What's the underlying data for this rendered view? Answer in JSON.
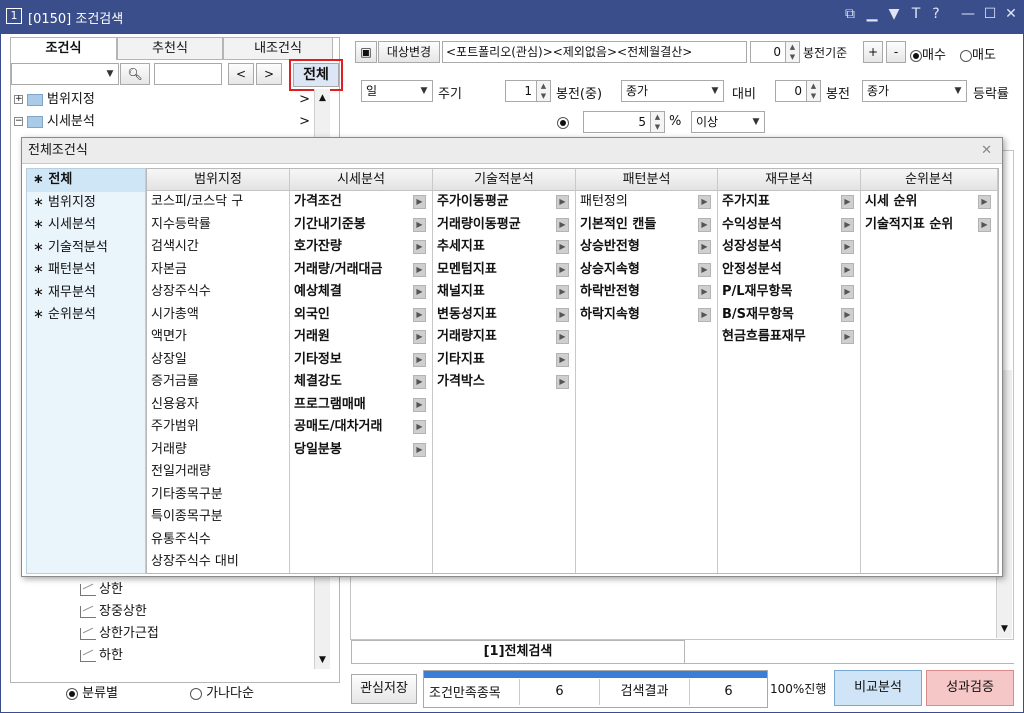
{
  "window": {
    "number": "1",
    "title": "[0150] 조건검색",
    "controls": [
      "restore-icon",
      "minimize-icon",
      "pin-icon",
      "text-icon",
      "help-icon",
      "minimize-icon",
      "maximize-icon",
      "close-icon"
    ]
  },
  "left_panel": {
    "tabs": [
      "조건식",
      "추천식",
      "내조건식"
    ],
    "active_tab": "조건식",
    "all_button": "전체",
    "tree": [
      {
        "label": "범위지정"
      },
      {
        "label": "시세분석"
      }
    ],
    "leaf_items": [
      "상한",
      "장중상한",
      "상한가근접",
      "하한"
    ],
    "sort_options": [
      "분류별",
      "가나다순"
    ],
    "selected_sort": "분류별"
  },
  "top_bar": {
    "target_button": "대상변경",
    "target_text": "<포트폴리오(관심)><제외없음><전체월결산>",
    "bong_count": "0",
    "bong_label": "봉전기준",
    "plus": "+",
    "minus": "-",
    "buy": "매수",
    "sell": "매도"
  },
  "condition_row": {
    "period_value": "일",
    "period_label": "주기",
    "bong_mid_value": "1",
    "bong_mid_label": "봉전(중)",
    "price_value": "종가",
    "compare_label": "대비",
    "bong2_value": "0",
    "bong2_label": "봉전",
    "price2_value": "종가",
    "rate_label": "등락률",
    "pct_value": "5",
    "pct_unit": "%",
    "above_value": "이상"
  },
  "popup": {
    "title": "전체조건식",
    "categories": [
      "전체",
      "범위지정",
      "시세분석",
      "기술적분석",
      "패턴분석",
      "재무분석",
      "순위분석"
    ],
    "active_category": "전체",
    "columns": [
      {
        "header": "범위지정",
        "bold": false,
        "arrows": false,
        "items": [
          "코스피/코스닥 구",
          "지수등락률",
          "검색시간",
          "자본금",
          "상장주식수",
          "시가총액",
          "액면가",
          "상장일",
          "증거금률",
          "신용융자",
          "주가범위",
          "거래량",
          "전일거래량",
          "기타종목구분",
          "특이종목구분",
          "유통주식수",
          "상장주식수 대비"
        ]
      },
      {
        "header": "시세분석",
        "bold": true,
        "arrows": true,
        "items": [
          "가격조건",
          "기간내기준봉",
          "호가잔량",
          "거래량/거래대금",
          "예상체결",
          "외국인",
          "거래원",
          "기타정보",
          "체결강도",
          "프로그램매매",
          "공매도/대차거래",
          "당일분봉"
        ]
      },
      {
        "header": "기술적분석",
        "bold": true,
        "arrows": true,
        "items": [
          "주가이동평균",
          "거래량이동평균",
          "추세지표",
          "모멘텀지표",
          "채널지표",
          "변동성지표",
          "거래량지표",
          "기타지표",
          "가격박스"
        ]
      },
      {
        "header": "패턴분석",
        "bold": true,
        "arrows": true,
        "items": [
          "패턴정의",
          "기본적인 캔들",
          "상승반전형",
          "상승지속형",
          "하락반전형",
          "하락지속형"
        ]
      },
      {
        "header": "재무분석",
        "bold": true,
        "arrows": true,
        "items": [
          "주가지표",
          "수익성분석",
          "성장성분석",
          "안정성분석",
          "P/L재무항목",
          "B/S재무항목",
          "현금흐름표재무"
        ]
      },
      {
        "header": "순위분석",
        "bold": true,
        "arrows": true,
        "items": [
          "시세 순위",
          "기술적지표 순위"
        ]
      }
    ]
  },
  "bottom": {
    "tab_label": "[1]전체검색",
    "save_button": "관심저장",
    "match_label": "조건만족종목",
    "match_count": "6",
    "result_label": "검색결과",
    "result_count": "6",
    "progress_text": "100%진행",
    "progress": 1.0,
    "compare_button": "비교분석",
    "verify_button": "성과검증"
  },
  "colors": {
    "titlebar": "#3b4e8c",
    "highlight_border": "#e02020",
    "verify_bg": "#f6c7c7",
    "compare_bg": "#cfe4f7",
    "progress_fill": "#3a7fd5"
  }
}
